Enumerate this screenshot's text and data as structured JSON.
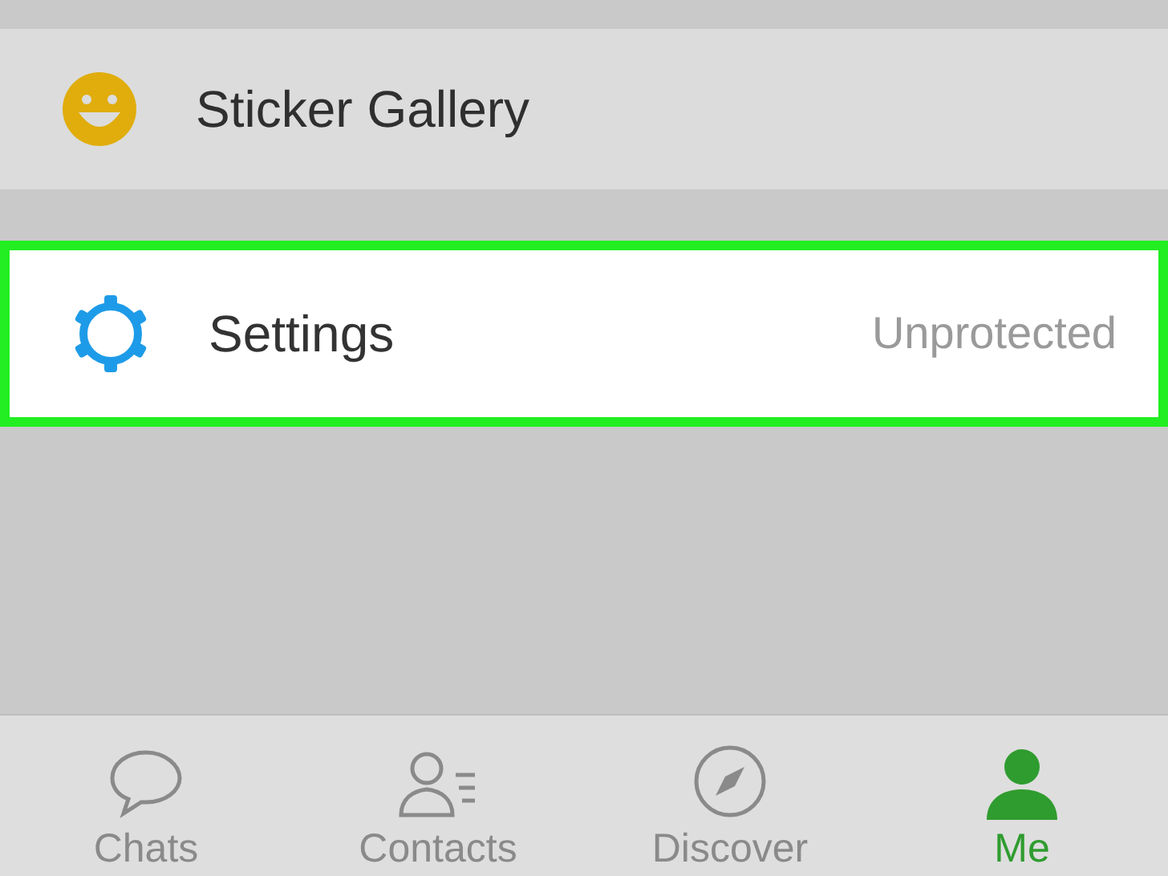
{
  "menu_rows": [
    {
      "kind": "sticker",
      "label": "Sticker Gallery",
      "highlighted": false
    },
    {
      "kind": "settings",
      "label": "Settings",
      "value": "Unprotected",
      "highlighted": true
    }
  ],
  "tab_bar": [
    {
      "kind": "chats",
      "label": "Chats",
      "selected": false
    },
    {
      "kind": "contacts",
      "label": "Contacts",
      "selected": false
    },
    {
      "kind": "discover",
      "label": "Discover",
      "selected": false
    },
    {
      "kind": "me",
      "label": "Me",
      "selected": true
    }
  ]
}
